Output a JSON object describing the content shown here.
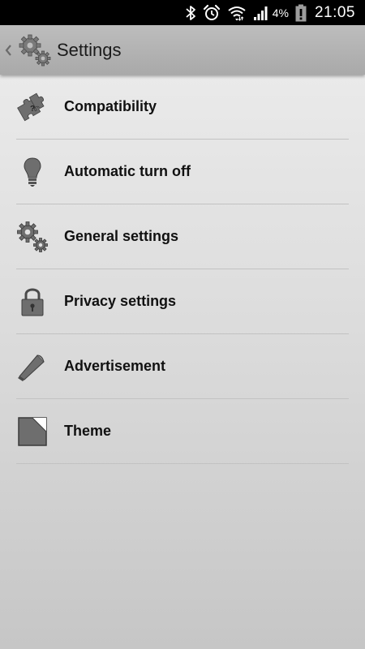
{
  "status_bar": {
    "battery_percent": "4%",
    "time": "21:05",
    "icons": [
      "bluetooth-icon",
      "alarm-icon",
      "wifi-icon",
      "signal-icon",
      "battery-alert-icon"
    ]
  },
  "action_bar": {
    "title": "Settings",
    "icon": "gears-icon"
  },
  "items": [
    {
      "label": "Compatibility",
      "icon": "puzzle-icon"
    },
    {
      "label": "Automatic turn off",
      "icon": "lightbulb-icon"
    },
    {
      "label": "General settings",
      "icon": "gears-icon"
    },
    {
      "label": "Privacy settings",
      "icon": "padlock-icon"
    },
    {
      "label": "Advertisement",
      "icon": "megaphone-icon"
    },
    {
      "label": "Theme",
      "icon": "theme-page-icon"
    }
  ],
  "colors": {
    "status_bar_bg": "#000000",
    "action_bar_bg": "#b3b3b3",
    "icon_gray": "#6e6e6e",
    "text": "#111111"
  }
}
